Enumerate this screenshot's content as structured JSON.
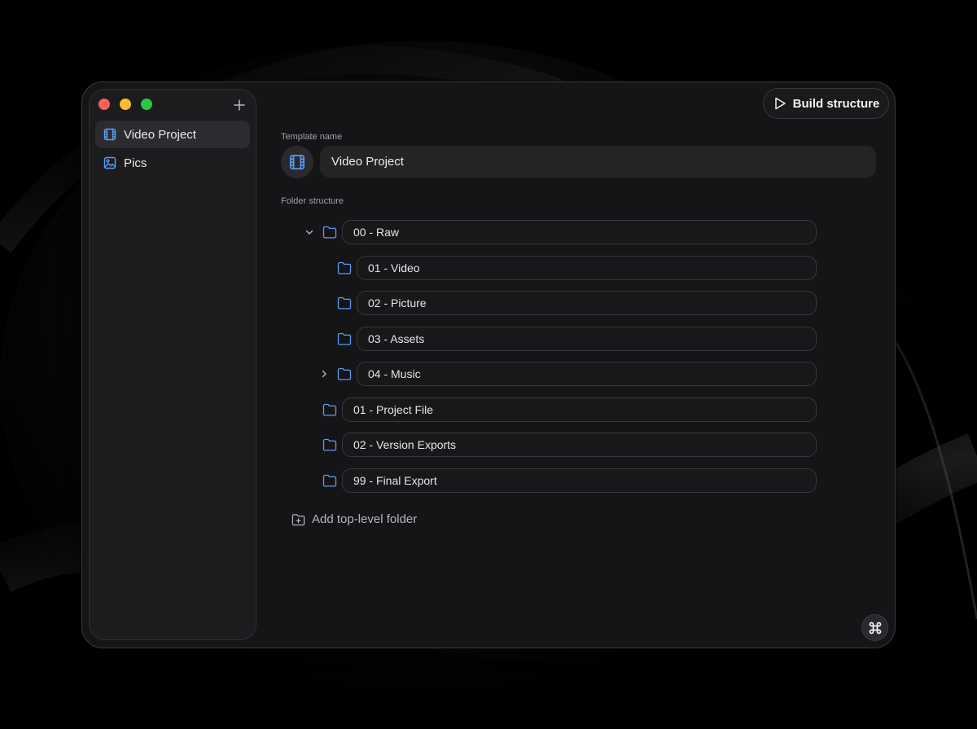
{
  "sidebar": {
    "items": [
      {
        "label": "Video Project",
        "icon": "film-icon",
        "active": true
      },
      {
        "label": "Pics",
        "icon": "image-icon",
        "active": false
      }
    ]
  },
  "toolbar": {
    "build_label": "Build structure"
  },
  "template": {
    "name_label": "Template name",
    "name_value": "Video Project",
    "icon": "film-icon"
  },
  "folders": {
    "label": "Folder structure",
    "items": [
      {
        "name": "00 - Raw",
        "depth": 0,
        "expander": "expanded"
      },
      {
        "name": "01 - Video",
        "depth": 1,
        "expander": "none"
      },
      {
        "name": "02 - Picture",
        "depth": 1,
        "expander": "none"
      },
      {
        "name": "03 - Assets",
        "depth": 1,
        "expander": "none"
      },
      {
        "name": "04 - Music",
        "depth": 1,
        "expander": "collapsed"
      },
      {
        "name": "01 - Project File",
        "depth": 0,
        "expander": "none"
      },
      {
        "name": "02 - Version Exports",
        "depth": 0,
        "expander": "none"
      },
      {
        "name": "99 - Final Export",
        "depth": 0,
        "expander": "none"
      }
    ],
    "add_label": "Add top-level folder"
  },
  "colors": {
    "accent": "#5b9cf6",
    "background": "#151517"
  }
}
